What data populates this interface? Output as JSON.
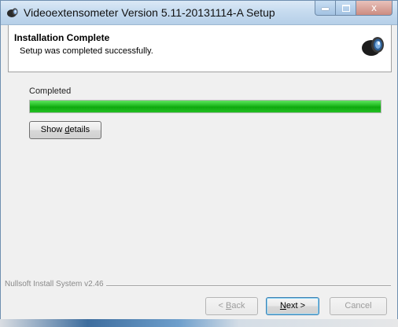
{
  "window": {
    "title": "Videoextensometer Version 5.11-20131114-A Setup",
    "icon": "camera-lens-icon",
    "controls": {
      "minimize": "minimize-icon",
      "maximize": "maximize-icon",
      "close_glyph": "x"
    }
  },
  "header": {
    "title": "Installation Complete",
    "subtitle": "Setup was completed successfully.",
    "logo": "camera-lens-icon"
  },
  "main": {
    "status_label": "Completed",
    "progress_percent": 100,
    "show_details": {
      "before": "Show ",
      "accel": "d",
      "after": "etails"
    }
  },
  "footer": {
    "branding": "Nullsoft Install System v2.46",
    "back": {
      "before": "< ",
      "accel": "B",
      "after": "ack",
      "enabled": false
    },
    "next": {
      "before": "",
      "accel": "N",
      "after": "ext >",
      "enabled": true,
      "default": true
    },
    "cancel": {
      "label": "Cancel",
      "enabled": false
    }
  },
  "colors": {
    "progress_fill": "#1fb81f",
    "titlebar": "#c6dbef",
    "dialog_bg": "#f0f0f0"
  }
}
